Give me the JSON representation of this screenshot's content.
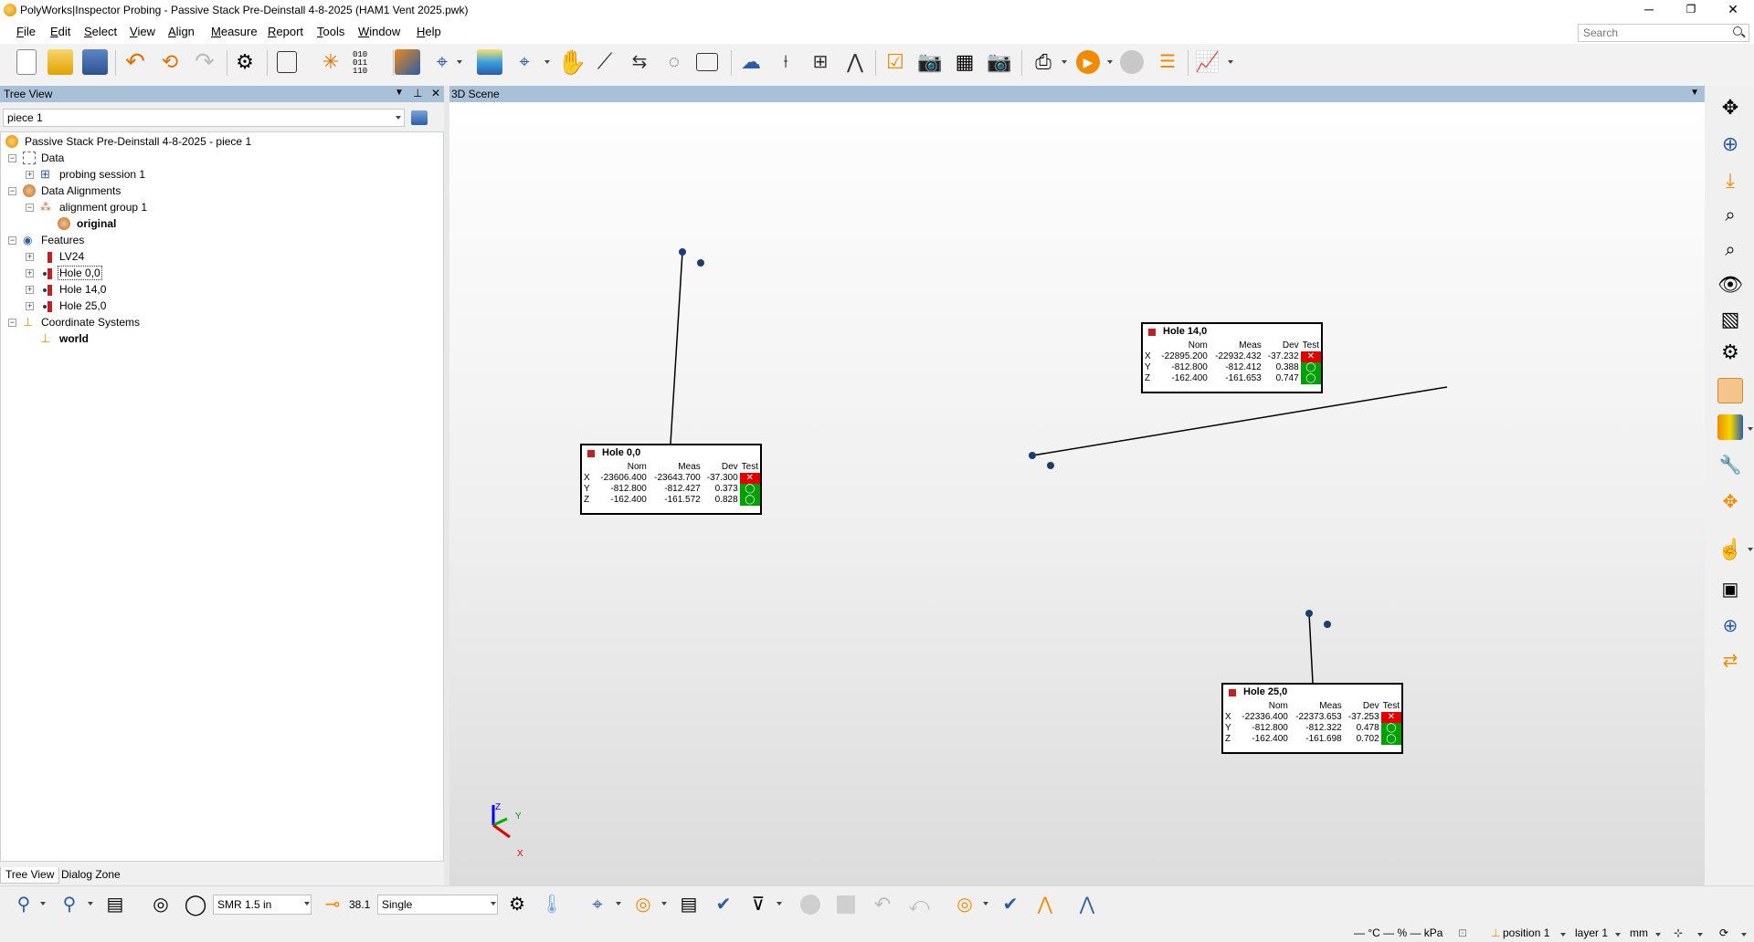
{
  "window": {
    "title": "PolyWorks|Inspector Probing - Passive Stack Pre-Deinstall 4-8-2025 (HAM1 Vent 2025.pwk)",
    "controls": [
      "─",
      "❐",
      "✕"
    ]
  },
  "menu": [
    {
      "u": "F",
      "rest": "ile"
    },
    {
      "u": "E",
      "rest": "dit"
    },
    {
      "u": "S",
      "rest": "elect"
    },
    {
      "u": "V",
      "rest": "iew"
    },
    {
      "u": "A",
      "rest": "lign"
    },
    {
      "u": "M",
      "rest": "easure"
    },
    {
      "u": "R",
      "rest": "eport"
    },
    {
      "u": "T",
      "rest": "ools"
    },
    {
      "u": "W",
      "rest": "indow"
    },
    {
      "u": "H",
      "rest": "elp"
    }
  ],
  "search": {
    "placeholder": "Search"
  },
  "tree_view": {
    "header": "Tree View",
    "header_buttons": [
      "▼",
      "⊥",
      "✕"
    ],
    "piece_selector": "piece 1",
    "items": [
      {
        "label": "Passive Stack Pre-Deinstall 4-8-2025 - piece 1",
        "bold": false
      },
      {
        "label": "Data",
        "bold": false
      },
      {
        "label": "probing session 1",
        "bold": false
      },
      {
        "label": "Data Alignments",
        "bold": false
      },
      {
        "label": "alignment group 1",
        "bold": false
      },
      {
        "label": "original",
        "bold": true
      },
      {
        "label": "Features",
        "bold": false
      },
      {
        "label": "LV24",
        "bold": false
      },
      {
        "label": "Hole 0,0",
        "bold": false
      },
      {
        "label": "Hole 14,0",
        "bold": false
      },
      {
        "label": "Hole 25,0",
        "bold": false
      },
      {
        "label": "Coordinate Systems",
        "bold": false
      },
      {
        "label": "world",
        "bold": true
      }
    ],
    "tabs": [
      "Tree View",
      "Dialog Zone"
    ]
  },
  "scene": {
    "header": "3D Scene",
    "callouts": [
      {
        "name": "Hole 0,0",
        "columns": [
          "Nom",
          "Meas",
          "Dev",
          "Test"
        ],
        "rows": [
          {
            "axis": "X",
            "nom": "-23606.400",
            "meas": "-23643.700",
            "dev": "-37.300",
            "test": "fail"
          },
          {
            "axis": "Y",
            "nom": "-812.800",
            "meas": "-812.427",
            "dev": "0.373",
            "test": "pass"
          },
          {
            "axis": "Z",
            "nom": "-162.400",
            "meas": "-161.572",
            "dev": "0.828",
            "test": "pass"
          }
        ]
      },
      {
        "name": "Hole 14,0",
        "columns": [
          "Nom",
          "Meas",
          "Dev",
          "Test"
        ],
        "rows": [
          {
            "axis": "X",
            "nom": "-22895.200",
            "meas": "-22932.432",
            "dev": "-37.232",
            "test": "fail"
          },
          {
            "axis": "Y",
            "nom": "-812.800",
            "meas": "-812.412",
            "dev": "0.388",
            "test": "pass"
          },
          {
            "axis": "Z",
            "nom": "-162.400",
            "meas": "-161.653",
            "dev": "0.747",
            "test": "pass"
          }
        ]
      },
      {
        "name": "Hole 25,0",
        "columns": [
          "Nom",
          "Meas",
          "Dev",
          "Test"
        ],
        "rows": [
          {
            "axis": "X",
            "nom": "-22336.400",
            "meas": "-22373.653",
            "dev": "-37.253",
            "test": "fail"
          },
          {
            "axis": "Y",
            "nom": "-812.800",
            "meas": "-812.322",
            "dev": "0.478",
            "test": "pass"
          },
          {
            "axis": "Z",
            "nom": "-162.400",
            "meas": "-161.698",
            "dev": "0.702",
            "test": "pass"
          }
        ]
      }
    ],
    "triad": {
      "x": "X",
      "y": "Y",
      "z": "Z"
    }
  },
  "bottom_toolbar": {
    "probe": "SMR 1.5 in",
    "probe_value": "38.1",
    "mode": "Single"
  },
  "status": {
    "environment": "— °C — % — kPa",
    "position": "position 1",
    "layer": "layer 1",
    "units": "mm"
  },
  "colors": {
    "fail": "#e00000",
    "pass": "#00a000",
    "panel_header": "#a9c0d9",
    "accent_orange": "#f08a00"
  }
}
